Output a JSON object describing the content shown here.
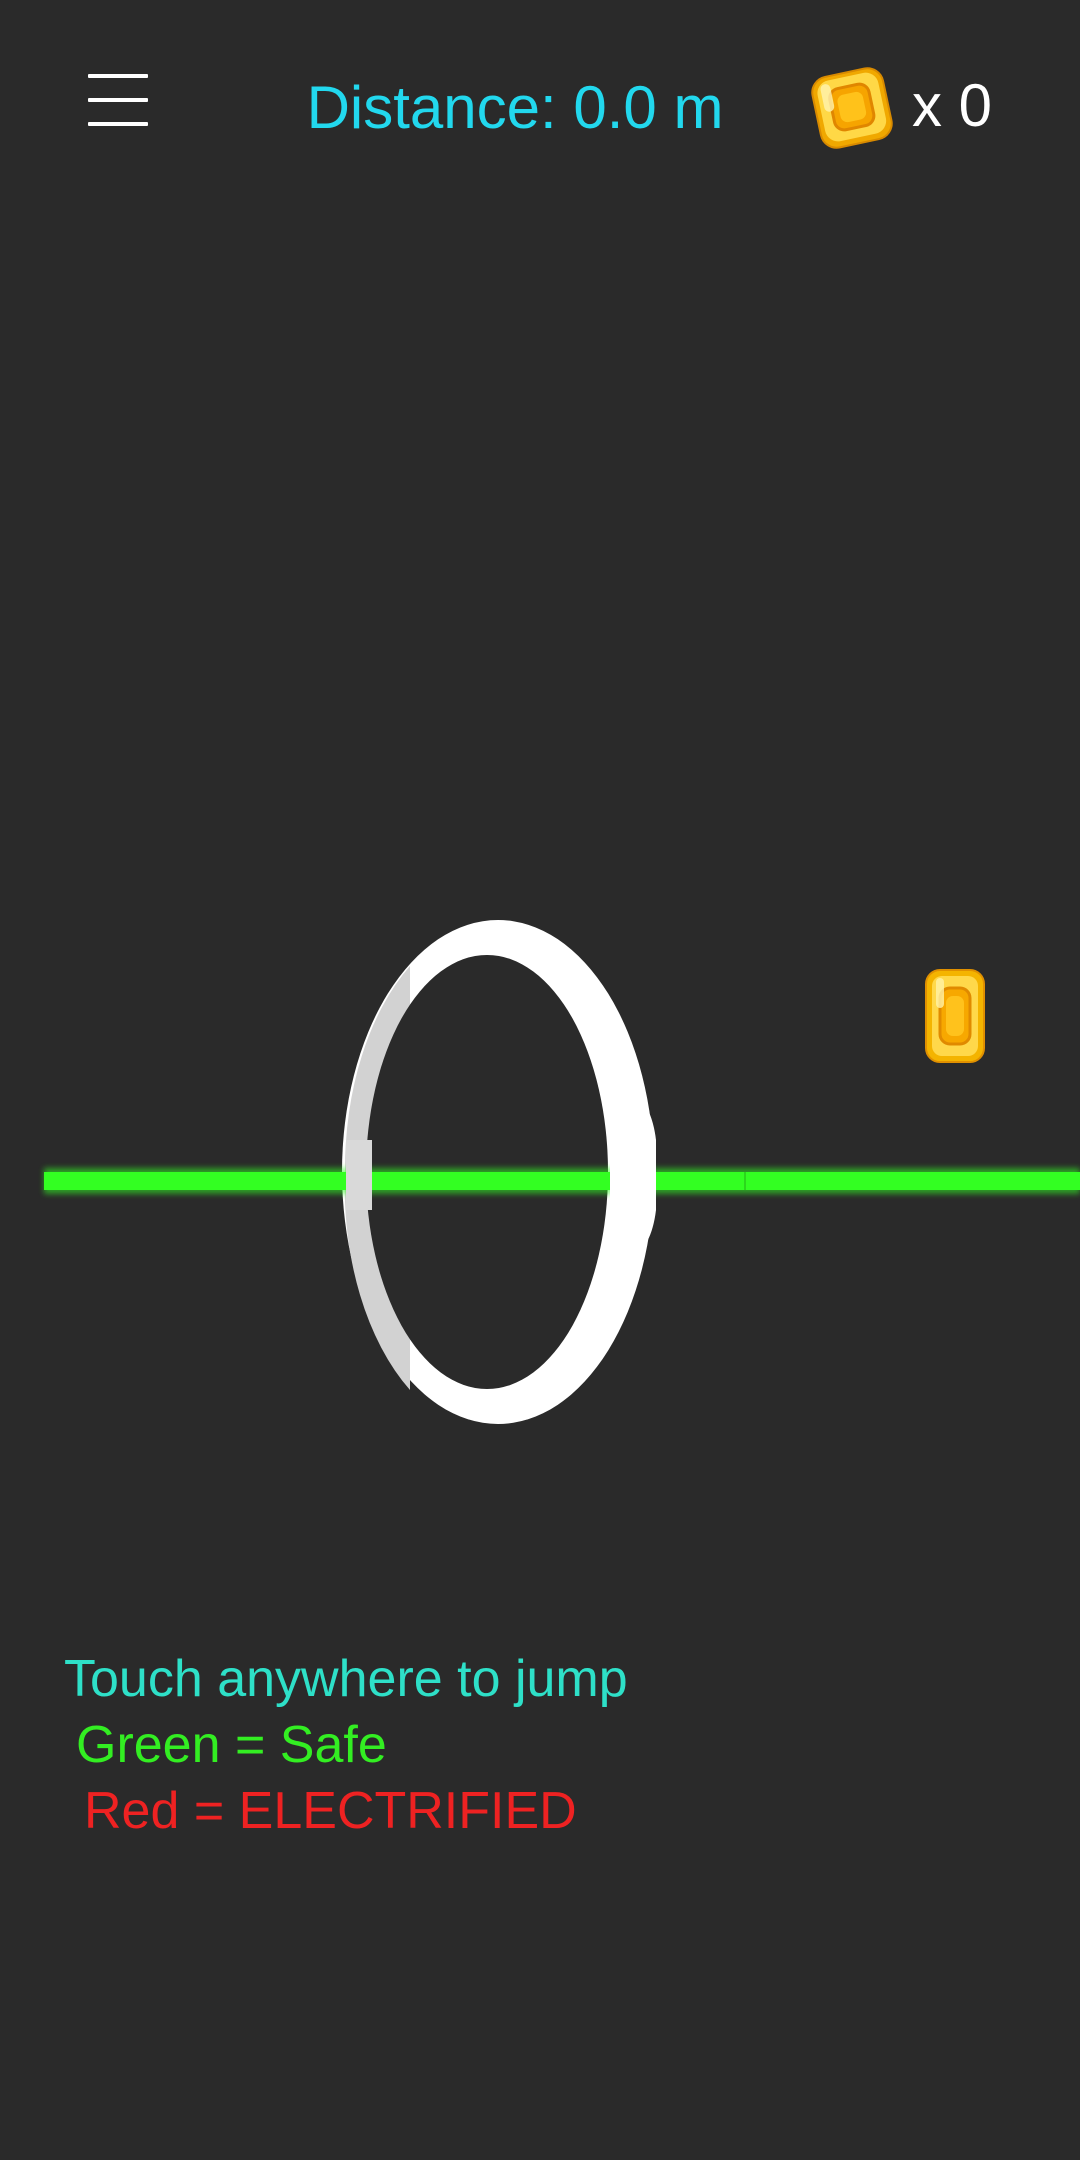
{
  "hud": {
    "menu_icon": "hamburger-menu-icon",
    "distance": {
      "label": "Distance:",
      "value": "0.0",
      "unit": "m",
      "color": "#22d8ee"
    },
    "coins": {
      "icon": "gold-coin-icon",
      "count_text": "x 0",
      "count": 0
    }
  },
  "scene": {
    "rail_color": "#33ff22",
    "ring_color": "#ffffff",
    "pickup_icon": "gold-coin-icon",
    "background": "#2a2a2a"
  },
  "instructions": {
    "line1": "Touch anywhere to jump",
    "line1_color": "#2ee0c8",
    "line2": "Green = Safe",
    "line2_color": "#33ee22",
    "line3": "Red = ELECTRIFIED",
    "line3_color": "#ee2222"
  }
}
